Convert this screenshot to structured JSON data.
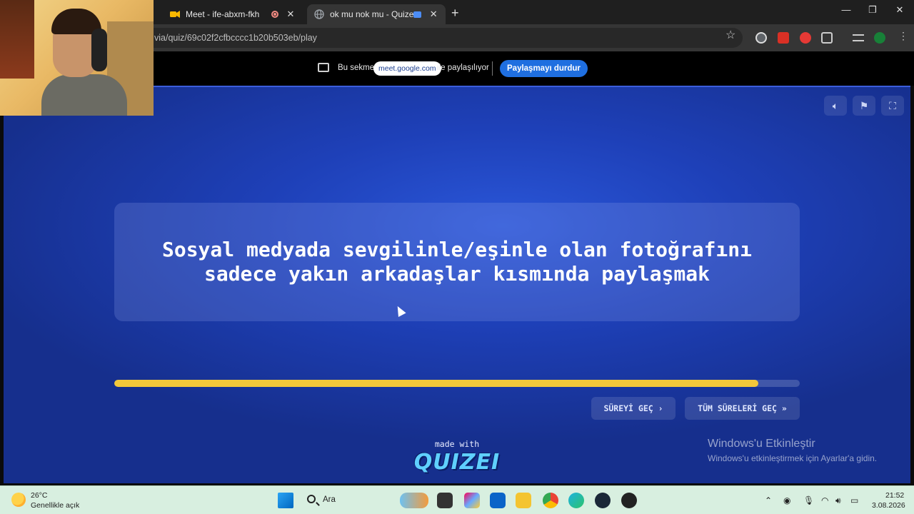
{
  "browser": {
    "tabs": [
      {
        "title": "Meet - ife-abxm-fkh",
        "favicon": "google-meet-icon",
        "badge": "recording-icon"
      },
      {
        "title": "ok mu nok mu - Quizei",
        "favicon": "globe-icon",
        "badge": "sharing-icon"
      }
    ],
    "new_tab_label": "+",
    "close_label": "✕",
    "url": "via/quiz/69c02f2cfbcccc1b20b503eb/play",
    "window_controls": [
      "—",
      "❐",
      "✕"
    ]
  },
  "share_bar": {
    "prefix": "Bu sekme",
    "domain": "meet.google.com",
    "suffix": "ile paylaşılıyor",
    "stop_label": "Paylaşmayı durdur"
  },
  "quiz": {
    "question": "Sosyal medyada sevgilinle/eşinle olan fotoğrafını sadece yakın arkadaşlar kısmında paylaşmak",
    "progress_percent": 94,
    "skip_timer_label": "SÜREYİ GEÇ",
    "skip_all_label": "TÜM SÜRELERİ GEÇ",
    "made_with": "made with",
    "brand": "QUIZEI",
    "tools": [
      "volume-icon",
      "flag-icon",
      "fullscreen-icon"
    ],
    "accent_color": "#f3c83a",
    "background_color": "#1e40b8"
  },
  "watermark": {
    "title": "Windows'u Etkinleştir",
    "subtitle": "Windows'u etkinleştirmek için Ayarlar'a gidin."
  },
  "taskbar": {
    "temperature": "26°C",
    "weather": "Genellikle açık",
    "search_placeholder": "Ara",
    "time": "21:52",
    "date": "3.08.2026"
  }
}
